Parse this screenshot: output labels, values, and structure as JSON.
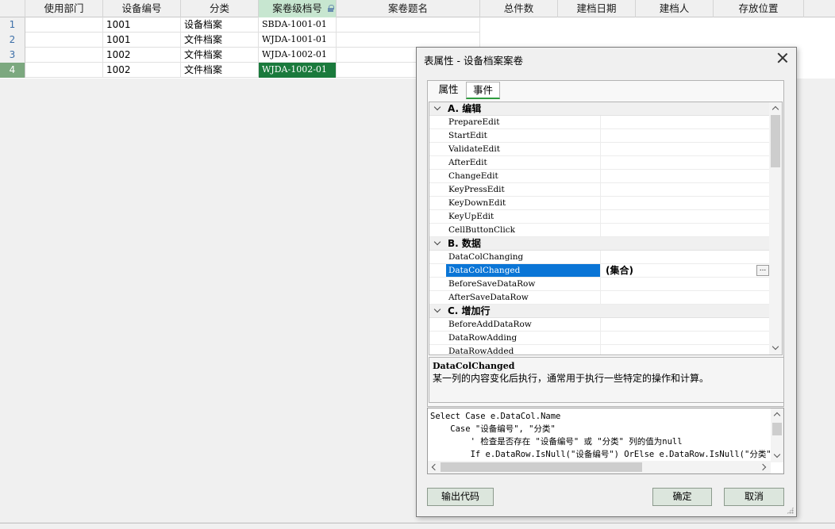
{
  "grid": {
    "columns": [
      "",
      "使用部门",
      "设备编号",
      "分类",
      "案卷级档号",
      "案卷题名",
      "总件数",
      "建档日期",
      "建档人",
      "存放位置",
      ""
    ],
    "rows": [
      {
        "num": "1",
        "cells": [
          "",
          "1001",
          "设备档案",
          "SBDA-1001-01",
          "",
          "",
          "",
          "",
          "",
          ""
        ]
      },
      {
        "num": "2",
        "cells": [
          "",
          "1001",
          "文件档案",
          "WJDA-1001-01",
          "",
          "",
          "",
          "",
          "",
          ""
        ]
      },
      {
        "num": "3",
        "cells": [
          "",
          "1002",
          "文件档案",
          "WJDA-1002-01",
          "",
          "",
          "",
          "",
          "",
          ""
        ]
      },
      {
        "num": "4",
        "cells": [
          "",
          "1002",
          "文件档案",
          "WJDA-1002-01",
          "",
          "",
          "",
          "",
          "",
          ""
        ]
      }
    ]
  },
  "dialog": {
    "title": "表属性 - 设备档案案卷",
    "tabs": [
      "属性",
      "事件"
    ],
    "active_tab": "事件",
    "categories": [
      {
        "label": "A. 编辑",
        "items": [
          "PrepareEdit",
          "StartEdit",
          "ValidateEdit",
          "AfterEdit",
          "ChangeEdit",
          "KeyPressEdit",
          "KeyDownEdit",
          "KeyUpEdit",
          "CellButtonClick"
        ]
      },
      {
        "label": "B. 数据",
        "items": [
          "DataColChanging",
          "DataColChanged",
          "BeforeSaveDataRow",
          "AfterSaveDataRow"
        ]
      },
      {
        "label": "C. 增加行",
        "items": [
          "BeforeAddDataRow",
          "DataRowAdding",
          "DataRowAdded"
        ]
      }
    ],
    "selected_item": "DataColChanged",
    "selected_value": "(集合)",
    "ellipsis": "...",
    "description": {
      "title": "DataColChanged",
      "text": "某一列的内容变化后执行，通常用于执行一些特定的操作和计算。"
    },
    "code_lines": [
      "Select Case e.DataCol.Name",
      "    Case \"设备编号\", \"分类\"",
      "        ' 检查是否存在 \"设备编号\" 或 \"分类\" 列的值为null",
      "        If e.DataRow.IsNull(\"设备编号\") OrElse e.DataRow.IsNull(\"分类\")"
    ],
    "buttons": {
      "export": "输出代码",
      "ok": "确定",
      "cancel": "取消"
    }
  },
  "colors": {
    "accent_green": "#1a7a3c",
    "selection_blue": "#0a75d6",
    "tab_underline": "#2e9c3e"
  }
}
